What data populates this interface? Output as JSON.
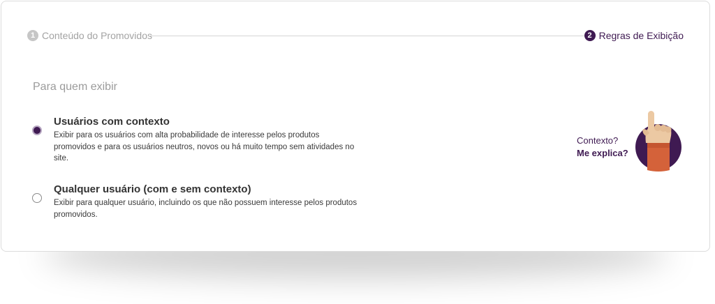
{
  "stepper": {
    "steps": [
      {
        "number": "1",
        "label": "Conteúdo do Promovidos",
        "state": "done"
      },
      {
        "number": "2",
        "label": "Regras de Exibição",
        "state": "active"
      }
    ]
  },
  "section": {
    "title": "Para quem exibir"
  },
  "options": [
    {
      "title": "Usuários com contexto",
      "description": "Exibir para os usuários com alta probabilidade de interesse pelos produtos promovidos e para os usuários neutros, novos ou há muito tempo sem atividades no site.",
      "selected": true
    },
    {
      "title": "Qualquer usuário (com e sem contexto)",
      "description": "Exibir para qualquer usuário, incluindo os que não possuem interesse pelos produtos promovidos.",
      "selected": false
    }
  ],
  "helper": {
    "question": "Contexto?",
    "link": "Me explica?",
    "icon": "pointing-hand-icon"
  },
  "colors": {
    "brand": "#3f1a52",
    "accent": "#d4623a",
    "muted": "#a3a3a3"
  }
}
